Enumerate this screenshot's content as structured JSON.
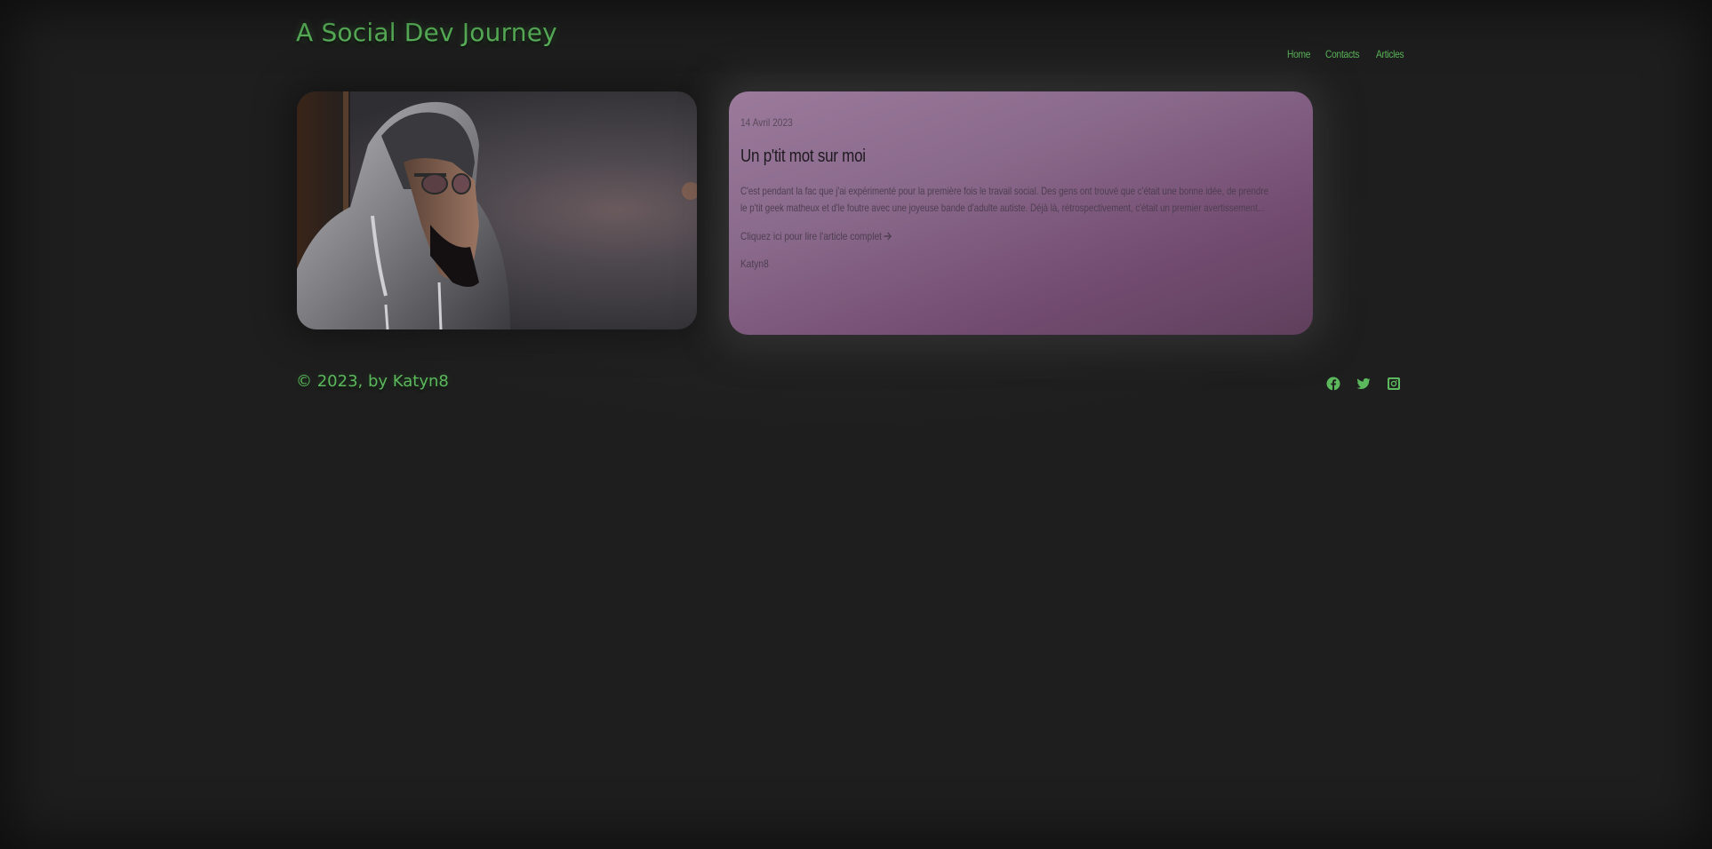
{
  "header": {
    "site_title": "A Social Dev Journey",
    "nav": [
      {
        "label": "Home"
      },
      {
        "label": "Contacts"
      },
      {
        "label": "Articles"
      }
    ]
  },
  "article": {
    "image_icon": "portrait-image",
    "date": "14 Avril 2023",
    "title": "Un p'tit mot sur moi",
    "excerpt": "C'est pendant la fac que j'ai expérimenté pour la première fois le travail social. Des gens ont trouvé que c'était une bonne idée, de prendre le p'tit geek matheux et d'le foutre avec une joyeuse bande d'adulte autiste. Déjà là, rétrospectivement, c'était un premier avertissement...",
    "read_more": "Cliquez ici pour lire l'article complet",
    "read_more_icon": "arrow-right-icon",
    "author": "Katyn8"
  },
  "footer": {
    "copyright": "© 2023, by Katyn8",
    "socials": [
      {
        "icon": "facebook-icon"
      },
      {
        "icon": "twitter-icon"
      },
      {
        "icon": "instagram-icon"
      }
    ]
  },
  "colors": {
    "background": "#1e1e1e",
    "accent_green": "#5cb85c",
    "card_purple": "#8a6a8c"
  }
}
